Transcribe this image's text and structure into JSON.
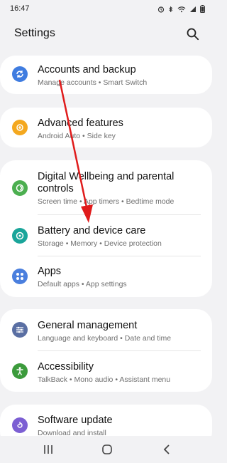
{
  "status_bar": {
    "time": "16:47"
  },
  "header": {
    "title": "Settings"
  },
  "colors": {
    "background": "#f2f2f4",
    "card": "#ffffff",
    "accounts": "#3f7ce0",
    "advanced": "#f4a81f",
    "wellbeing": "#4caf50",
    "battery": "#1aa59a",
    "apps": "#4a7fde",
    "general": "#5a6fa3",
    "accessibility": "#3c9b3c",
    "software": "#7c5fd3",
    "annotation_arrow": "#e01b1b"
  },
  "items": {
    "accounts": {
      "icon": "sync-icon",
      "label": "Accounts and backup",
      "subtitle": "Manage accounts  •  Smart Switch"
    },
    "advanced": {
      "icon": "plus-gear-icon",
      "label": "Advanced features",
      "subtitle": "Android Auto  •  Side key"
    },
    "wellbeing": {
      "icon": "wellbeing-icon",
      "label": "Digital Wellbeing and parental controls",
      "subtitle": "Screen time  •  App timers  •  Bedtime mode"
    },
    "battery": {
      "icon": "battery-care-icon",
      "label": "Battery and device care",
      "subtitle": "Storage  •  Memory  •  Device protection"
    },
    "apps": {
      "icon": "apps-grid-icon",
      "label": "Apps",
      "subtitle": "Default apps  •  App settings"
    },
    "general": {
      "icon": "sliders-icon",
      "label": "General management",
      "subtitle": "Language and keyboard  •  Date and time"
    },
    "accessibility": {
      "icon": "person-icon",
      "label": "Accessibility",
      "subtitle": "TalkBack  •  Mono audio  •  Assistant menu"
    },
    "software": {
      "icon": "update-icon",
      "label": "Software update",
      "subtitle": "Download and install"
    }
  }
}
